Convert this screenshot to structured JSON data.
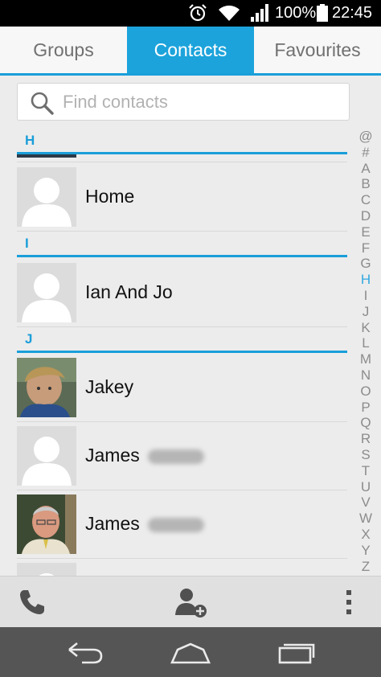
{
  "status_bar": {
    "battery_label": "100%",
    "time": "22:45",
    "icons": [
      "alarm-icon",
      "wifi-icon",
      "signal-icon",
      "battery-icon"
    ]
  },
  "tabs": [
    {
      "label": "Groups",
      "selected": false
    },
    {
      "label": "Contacts",
      "selected": true
    },
    {
      "label": "Favourites",
      "selected": false
    }
  ],
  "search": {
    "placeholder": "Find contacts",
    "value": ""
  },
  "sections": [
    {
      "letter": "H",
      "contacts": [
        {
          "name": "Home",
          "avatar": "placeholder"
        }
      ]
    },
    {
      "letter": "I",
      "contacts": [
        {
          "name": "Ian And Jo",
          "avatar": "placeholder"
        }
      ]
    },
    {
      "letter": "J",
      "contacts": [
        {
          "name": "Jakey",
          "avatar": "photo-boy"
        },
        {
          "name": "James",
          "avatar": "placeholder",
          "surname_obscured": true
        },
        {
          "name": "James",
          "avatar": "photo-man",
          "surname_obscured": true
        }
      ]
    }
  ],
  "index": [
    "@",
    "#",
    "A",
    "B",
    "C",
    "D",
    "E",
    "F",
    "G",
    "H",
    "I",
    "J",
    "K",
    "L",
    "M",
    "N",
    "O",
    "P",
    "Q",
    "R",
    "S",
    "T",
    "U",
    "V",
    "W",
    "X",
    "Y",
    "Z"
  ],
  "index_active": "H",
  "colors": {
    "accent": "#1ca3db",
    "background": "#ececec",
    "navbar": "#555555"
  },
  "actions": [
    "phone-icon",
    "add-contact-icon",
    "overflow-menu-icon"
  ],
  "nav": [
    "back-icon",
    "home-icon",
    "recent-apps-icon"
  ]
}
